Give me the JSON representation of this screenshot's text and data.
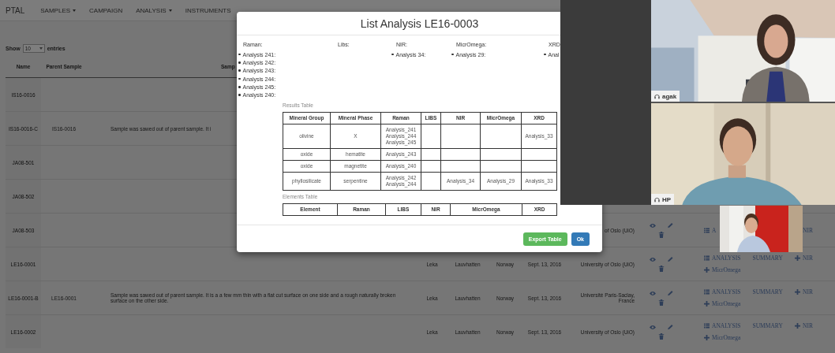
{
  "navbar": {
    "brand": "PTAL",
    "items": [
      {
        "label": "SAMPLES",
        "dropdown": true
      },
      {
        "label": "CAMPAIGN",
        "dropdown": false
      },
      {
        "label": "ANALYSIS",
        "dropdown": true
      },
      {
        "label": "INSTRUMENTS",
        "dropdown": false
      }
    ]
  },
  "page_length": {
    "label": "Show",
    "value": "10",
    "suffix": "entries"
  },
  "samples_table": {
    "columns": [
      "Name",
      "Parent Sample",
      "Samp"
    ],
    "rows": [
      {
        "name": "IS16-0016"
      },
      {
        "name": "IS16-0016-C",
        "parent": "IS16-0016",
        "description": "Sample was sawed out of parent sample. It i"
      },
      {
        "name": "JA08-501"
      },
      {
        "name": "JA08-502"
      },
      {
        "name": "JA08-503",
        "institution": "of Oslo (UiO)",
        "tools": true,
        "links": [
          {
            "kind": "list",
            "label": "A"
          },
          {
            "kind": "plain",
            "label": "NIR"
          }
        ]
      },
      {
        "name": "LE16-0001",
        "place": "Leka",
        "site": "Lauvhatten",
        "country": "Norway",
        "date": "Sept. 13, 2016",
        "institution": "University of Oslo (UiO)",
        "tools": true,
        "links": [
          {
            "kind": "list",
            "label": "ANALYSIS"
          },
          {
            "kind": "plain",
            "label": "SUMMARY"
          },
          {
            "kind": "plus",
            "label": "NIR"
          },
          {
            "kind": "plus",
            "label": "MicrOmega"
          }
        ]
      },
      {
        "name": "LE16-0001-B",
        "parent": "LE16-0001",
        "description": "Sample was sawed out of parent sample. It is a a few mm thin with a flat cut surface on one side and a rough naturally broken surface on the other side.",
        "place": "Leka",
        "site": "Lauvhatten",
        "country": "Norway",
        "date": "Sept. 13, 2016",
        "institution": "Université Paris-Saclay, France",
        "tools": true,
        "links": [
          {
            "kind": "list",
            "label": "ANALYSIS"
          },
          {
            "kind": "plain",
            "label": "SUMMARY"
          },
          {
            "kind": "plus",
            "label": "NIR"
          },
          {
            "kind": "plus",
            "label": "MicrOmega"
          }
        ]
      },
      {
        "name": "LE16-0002",
        "place": "Leka",
        "site": "Lauvhatten",
        "country": "Norway",
        "date": "Sept. 13, 2016",
        "institution": "University of Oslo (UiO)",
        "tools": true,
        "links": [
          {
            "kind": "list",
            "label": "ANALYSIS"
          },
          {
            "kind": "plain",
            "label": "SUMMARY"
          },
          {
            "kind": "plus",
            "label": "NIR"
          },
          {
            "kind": "plus",
            "label": "MicrOmega"
          }
        ]
      }
    ]
  },
  "modal": {
    "title": "List Analysis LE16-0003",
    "techniques": [
      {
        "name": "Raman:",
        "analyses": [
          "Analysis 241:",
          "Analysis 242:",
          "Analysis 243:",
          "Analysis 244:",
          "Analysis 245:",
          "Analysis 240:"
        ]
      },
      {
        "name": "Libs:"
      },
      {
        "name": "NIR:",
        "analyses": [
          "Analysis 34:"
        ]
      },
      {
        "name": "MicrOmega:",
        "analyses": [
          "Analysis 29:"
        ]
      },
      {
        "name": "XRD",
        "analyses": [
          "Anal"
        ]
      }
    ],
    "results_table": {
      "caption": "Results Table",
      "columns": [
        "Mineral Group",
        "Mineral Phase",
        "Raman",
        "LIBS",
        "NIR",
        "MicrOmega",
        "XRD"
      ],
      "rows": [
        [
          "olivine",
          "X",
          "Analysis_241\nAnalysis_244\nAnalysis_245",
          null,
          null,
          null,
          "Analysis_33"
        ],
        [
          "oxide",
          "hematite",
          "Analysis_243",
          null,
          null,
          null,
          null
        ],
        [
          "oxide",
          "magnetite",
          "Analysis_240",
          null,
          null,
          null,
          null
        ],
        [
          "phyllosilicate",
          "serpentine",
          "Analysis_242\nAnalysis_244",
          null,
          "Analysis_34",
          "Analysis_29",
          "Analysis_33"
        ]
      ]
    },
    "elements_table": {
      "caption": "Elements Table",
      "columns": [
        "Element",
        "Raman",
        "LIBS",
        "NIR",
        "MicrOmega",
        "XRD"
      ]
    },
    "buttons": [
      {
        "label": "Export Table",
        "kind": "success"
      },
      {
        "label": "Ok",
        "kind": "primary"
      }
    ]
  },
  "video_call": {
    "participants": [
      {
        "name": "agak"
      },
      {
        "name": "HP"
      }
    ]
  }
}
